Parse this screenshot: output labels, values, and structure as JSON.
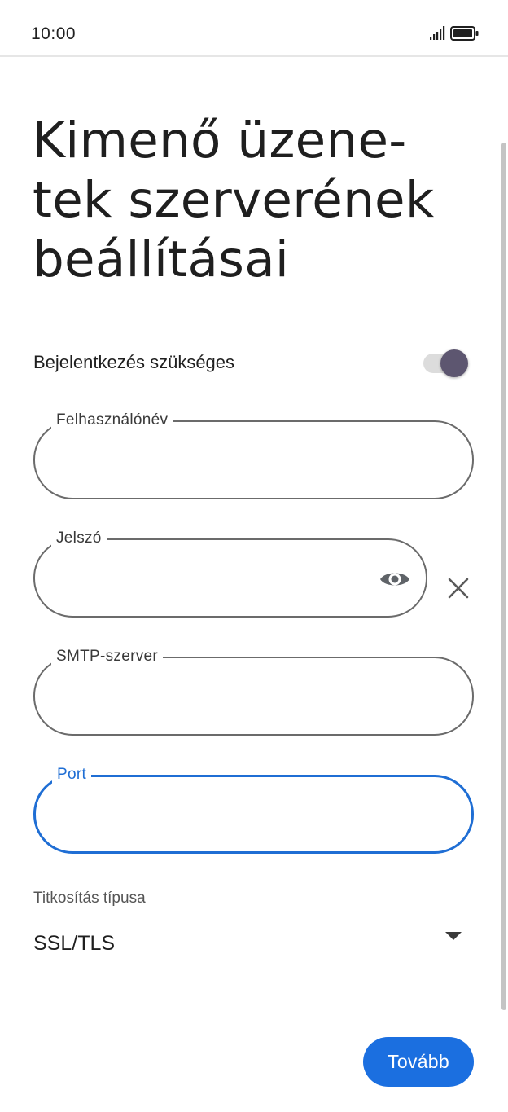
{
  "status_bar": {
    "time": "10:00",
    "icons": [
      "signal-icon",
      "battery-icon"
    ]
  },
  "page": {
    "title": "Kimenő üzene-\ntek szerverének beállításai"
  },
  "login_required": {
    "label": "Bejelentkezés szükséges",
    "enabled": true
  },
  "fields": {
    "username": {
      "label": "Felhasználónév",
      "value": ""
    },
    "password": {
      "label": "Jelszó",
      "value": "",
      "icons": [
        "eye-icon",
        "close-icon"
      ]
    },
    "smtp_server": {
      "label": "SMTP-szerver",
      "value": ""
    },
    "port": {
      "label": "Port",
      "value": "",
      "focused": true
    }
  },
  "encryption": {
    "label": "Titkosítás típusa",
    "selected": "SSL/TLS"
  },
  "actions": {
    "next_label": "Tovább"
  },
  "colors": {
    "accent": "#1b6fe0",
    "focus_outline": "#1f6ed4",
    "toggle_thumb": "#5d5670"
  }
}
